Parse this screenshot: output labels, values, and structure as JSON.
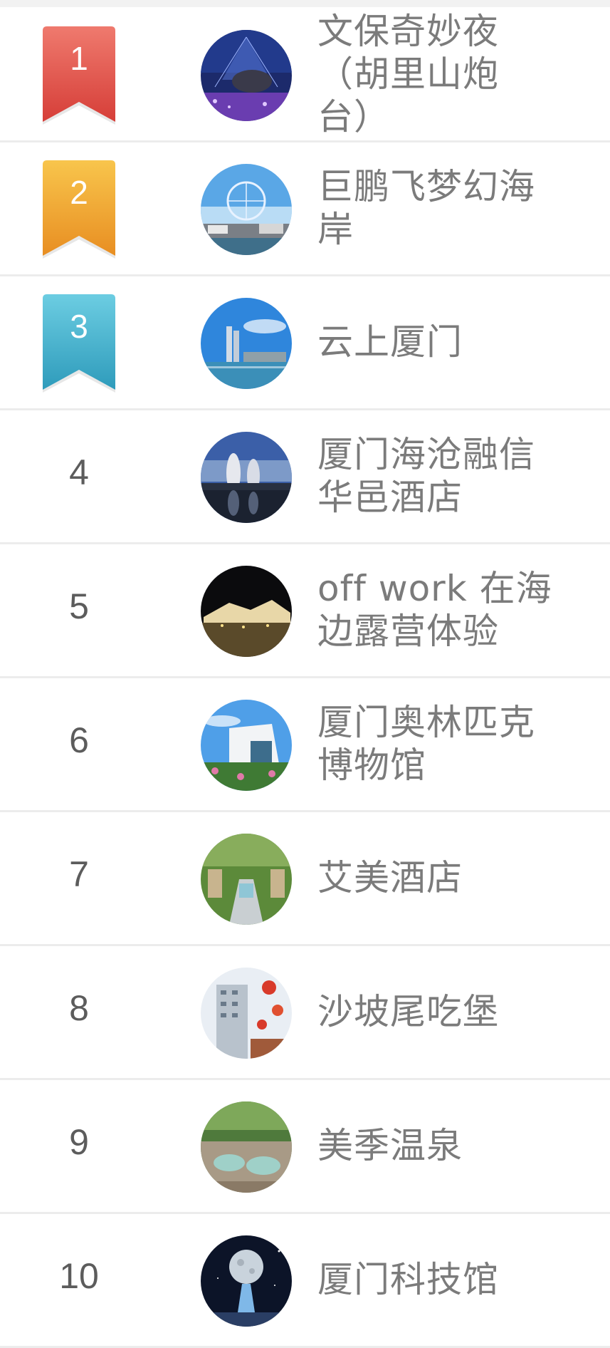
{
  "ranking": {
    "items": [
      {
        "rank": "1",
        "name": "文保奇妙夜（胡里山炮台）",
        "badge_color": "#dc4a44",
        "badge_color_light": "#ef7a6e"
      },
      {
        "rank": "2",
        "name": "巨鹏飞梦幻海岸",
        "badge_color": "#eb9a28",
        "badge_color_light": "#f8c54c"
      },
      {
        "rank": "3",
        "name": "云上厦门",
        "badge_color": "#39a6c4",
        "badge_color_light": "#6ccde2"
      },
      {
        "rank": "4",
        "name": "厦门海沧融信华邑酒店"
      },
      {
        "rank": "5",
        "name": "off work 在海边露营体验"
      },
      {
        "rank": "6",
        "name": "厦门奥林匹克博物馆"
      },
      {
        "rank": "7",
        "name": "艾美酒店"
      },
      {
        "rank": "8",
        "name": "沙坡尾吃堡"
      },
      {
        "rank": "9",
        "name": "美季温泉"
      },
      {
        "rank": "10",
        "name": "厦门科技馆"
      }
    ]
  }
}
